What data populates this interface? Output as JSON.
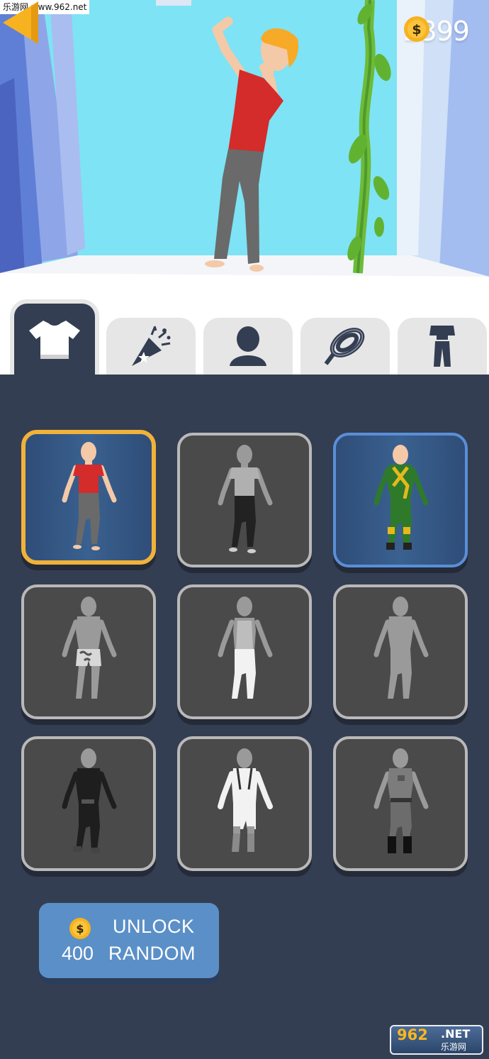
{
  "watermark": "乐游网 www.962.net",
  "coins": {
    "count": "2399",
    "symbol": "$"
  },
  "tabs": [
    {
      "name": "shirt",
      "active": true
    },
    {
      "name": "party-popper",
      "active": false
    },
    {
      "name": "avatar",
      "active": false
    },
    {
      "name": "rope",
      "active": false
    },
    {
      "name": "outfit",
      "active": false
    }
  ],
  "outfits": [
    {
      "name": "red-shirt-casual",
      "state": "selected"
    },
    {
      "name": "gray-shirt-black-pants",
      "state": "locked"
    },
    {
      "name": "green-yellow-suit",
      "state": "owned"
    },
    {
      "name": "patterned-shorts",
      "state": "locked"
    },
    {
      "name": "tank-top-white-pants",
      "state": "locked"
    },
    {
      "name": "plain-bodysuit",
      "state": "locked"
    },
    {
      "name": "black-martial-arts",
      "state": "locked"
    },
    {
      "name": "white-climber",
      "state": "locked"
    },
    {
      "name": "gray-soldier",
      "state": "locked"
    }
  ],
  "unlock": {
    "line1": "UNLOCK",
    "price": "400",
    "line2": "RANDOM",
    "symbol": "$"
  },
  "logo": {
    "number": "962",
    "net": ".NET",
    "site": "乐游网"
  },
  "colors": {
    "panel": "#343e52",
    "selected_border": "#f0b23a",
    "owned_border": "#5a8fd8",
    "button": "#5b8fc7"
  }
}
